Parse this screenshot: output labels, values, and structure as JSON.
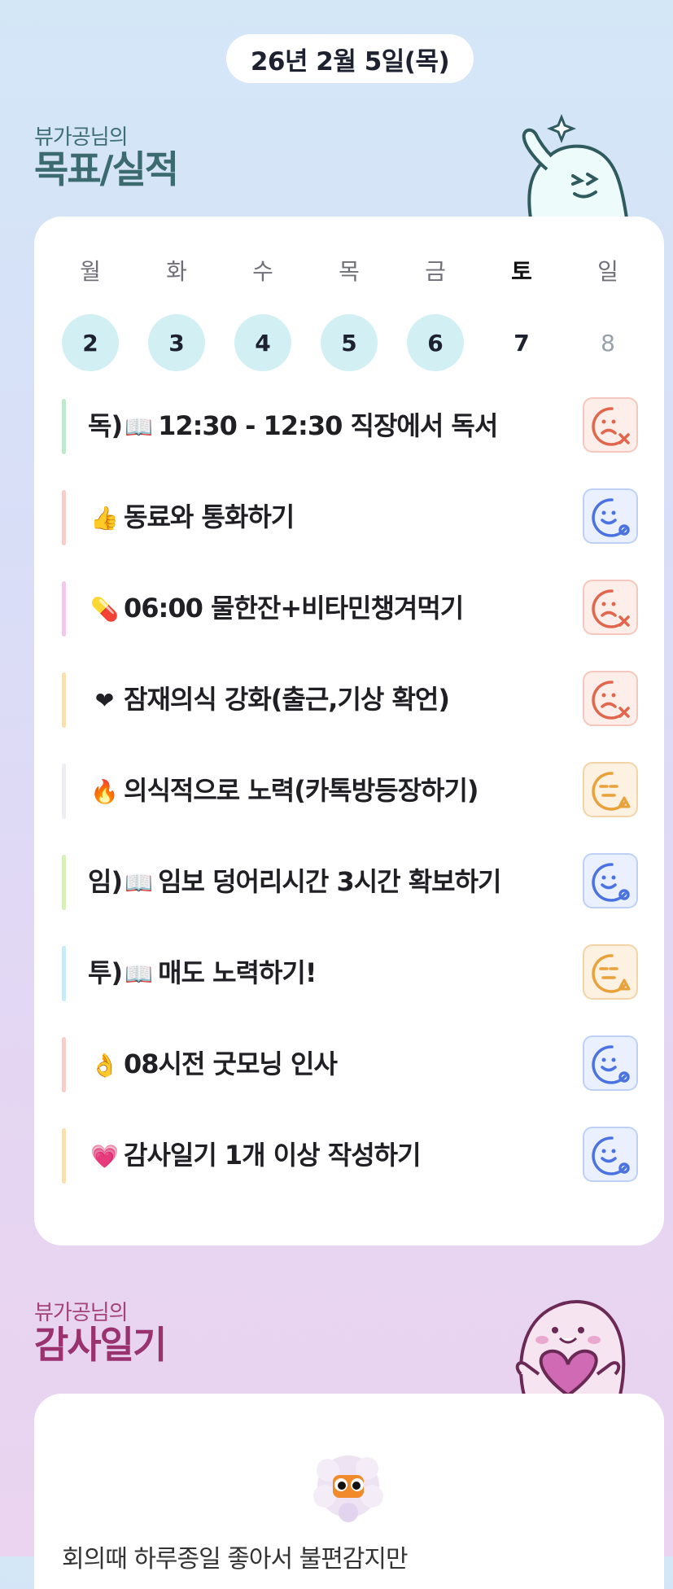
{
  "date_label": "26년 2월 5일(목)",
  "goals_section": {
    "subtitle": "뷰가공님의",
    "title": "목표/실적"
  },
  "week": [
    {
      "name": "월",
      "num": "2",
      "state": "done"
    },
    {
      "name": "화",
      "num": "3",
      "state": "done"
    },
    {
      "name": "수",
      "num": "4",
      "state": "done"
    },
    {
      "name": "목",
      "num": "5",
      "state": "done"
    },
    {
      "name": "금",
      "num": "6",
      "state": "done"
    },
    {
      "name": "토",
      "num": "7",
      "state": "today"
    },
    {
      "name": "일",
      "num": "8",
      "state": "future"
    }
  ],
  "goals": [
    {
      "prefix": "독)",
      "emoji": "📖",
      "label": "12:30 - 12:30 직장에서 독서",
      "status": "fail",
      "bar_color": "#bfe8cc"
    },
    {
      "prefix": "",
      "emoji": "👍",
      "label": "동료와 통화하기",
      "status": "ok",
      "bar_color": "#f7cfc8"
    },
    {
      "prefix": "",
      "emoji": "💊",
      "label": "06:00 물한잔+비타민챙겨먹기",
      "status": "fail",
      "bar_color": "#f2c9ea"
    },
    {
      "prefix": "",
      "emoji": "❤",
      "label": "잠재의식 강화(출근,기상 확언)",
      "status": "fail",
      "bar_color": "#f9e0b4"
    },
    {
      "prefix": "",
      "emoji": "🔥",
      "label": "의식적으로 노력(카톡방등장하기)",
      "status": "partial",
      "bar_color": "#eeeef2"
    },
    {
      "prefix": "임)",
      "emoji": "📖",
      "label": "임보 덩어리시간 3시간 확보하기",
      "status": "ok",
      "bar_color": "#d8efb8"
    },
    {
      "prefix": "투)",
      "emoji": "📖",
      "label": "매도 노력하기!",
      "status": "partial",
      "bar_color": "#c7ecf5"
    },
    {
      "prefix": "",
      "emoji": "👌",
      "label": "08시전 굿모닝 인사",
      "status": "ok",
      "bar_color": "#f7cfc8"
    },
    {
      "prefix": "",
      "emoji": "💗",
      "label": "감사일기 1개 이상 작성하기",
      "status": "ok",
      "bar_color": "#f9e0b4"
    }
  ],
  "diary_section": {
    "subtitle": "뷰가공님의",
    "title": "감사일기",
    "preview_text": "회의때 하루종일 좋아서 불편감지만"
  },
  "colors": {
    "fail": "#e0674d",
    "ok": "#4a72e0",
    "partial": "#e9a23a",
    "done_circle": "#d2eff3"
  },
  "icons": {
    "fail": "sad-face-x-icon",
    "ok": "smile-face-circle-icon",
    "partial": "neutral-face-triangle-icon"
  }
}
